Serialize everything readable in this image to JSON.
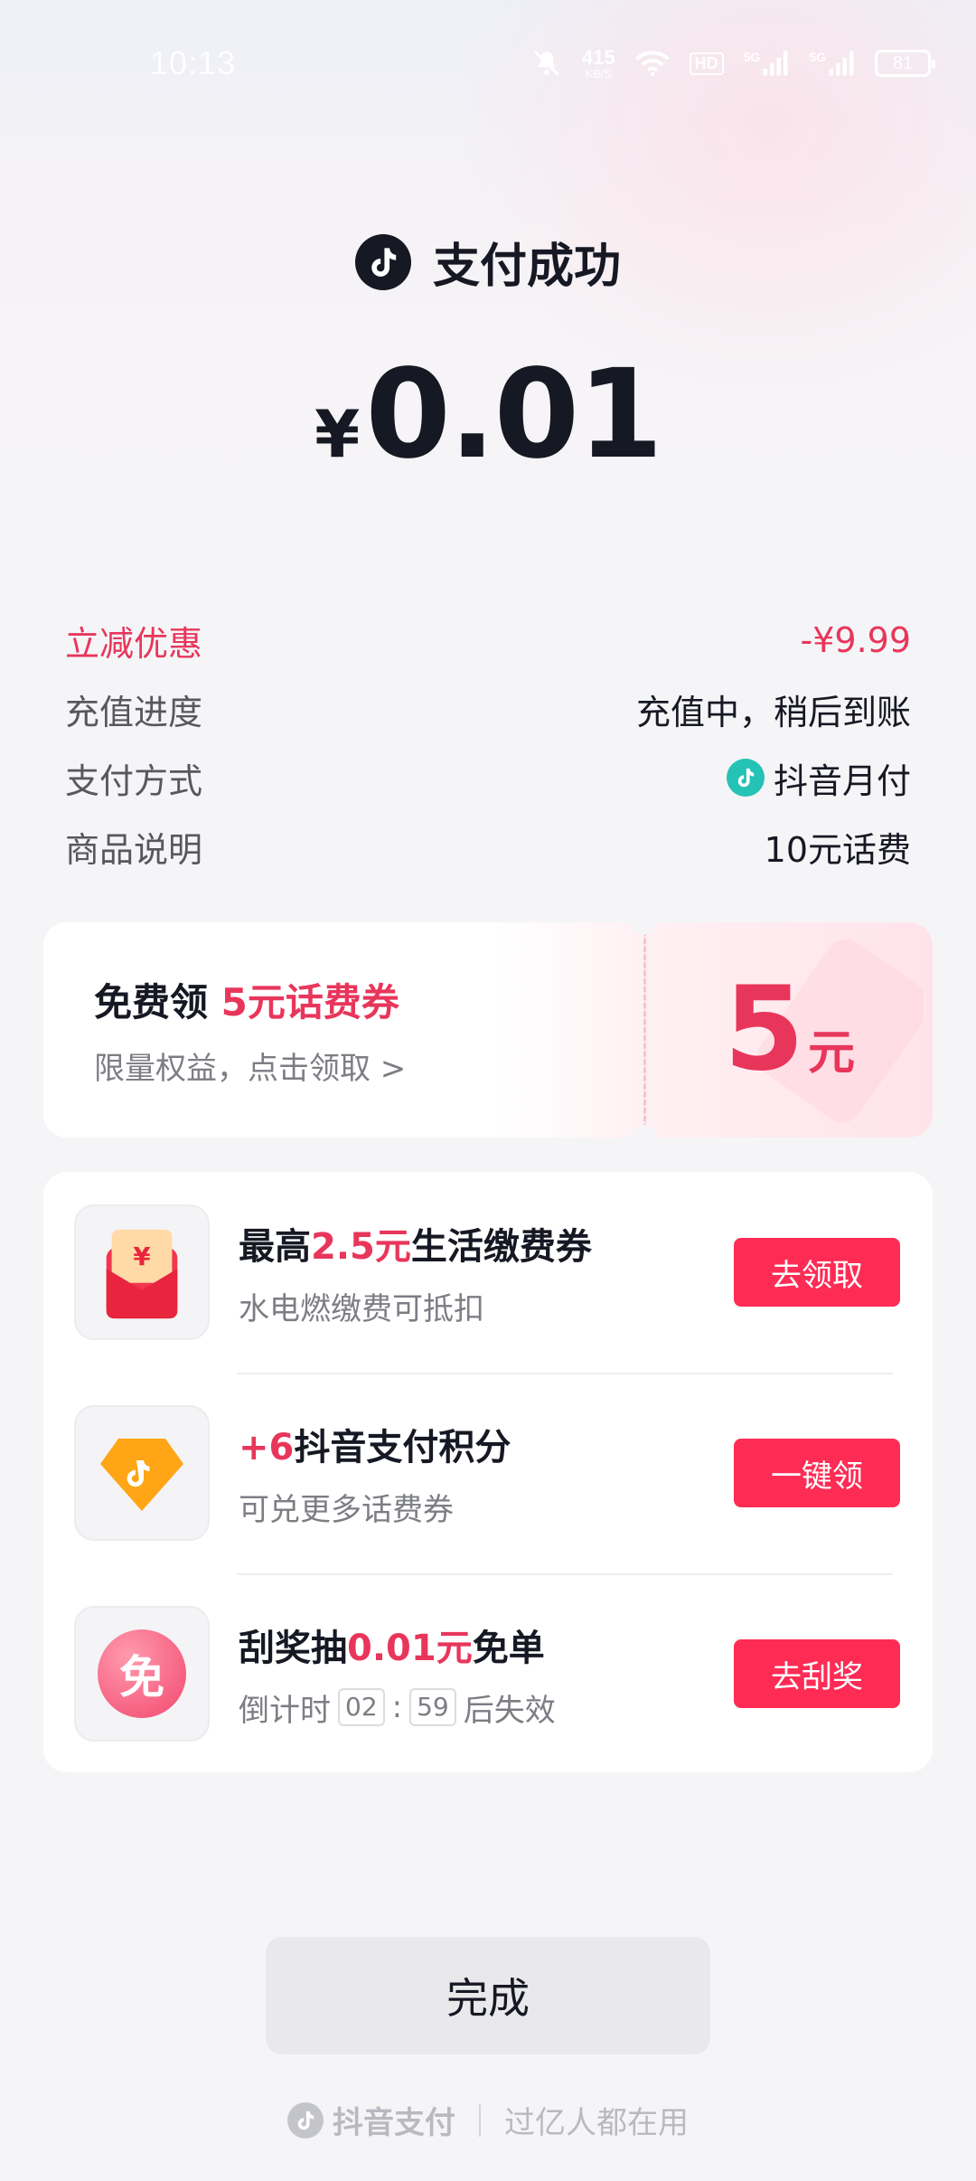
{
  "status_bar": {
    "time": "10:13",
    "speed_value": "415",
    "speed_unit": "KB/S",
    "hd_label": "HD",
    "signal_1": "5G",
    "signal_2": "5G",
    "battery": "81"
  },
  "header": {
    "title": "支付成功",
    "currency": "¥",
    "amount": "0.01"
  },
  "details": [
    {
      "label": "立减优惠",
      "value": "-¥9.99"
    },
    {
      "label": "充值进度",
      "value": "充值中，稍后到账"
    },
    {
      "label": "支付方式",
      "value": "抖音月付"
    },
    {
      "label": "商品说明",
      "value": "10元话费"
    }
  ],
  "coupon": {
    "title_prefix": "免费领 ",
    "title_highlight": "5元话费券",
    "subtitle": "限量权益，点击领取 >",
    "value": "5",
    "unit": "元"
  },
  "tasks": [
    {
      "title_prefix": "最高",
      "title_highlight": "2.5元",
      "title_suffix": "生活缴费券",
      "subtitle": "水电燃缴费可抵扣",
      "button": "去领取",
      "icon": "red-envelope-icon"
    },
    {
      "title_prefix": "",
      "title_highlight": "+6",
      "title_suffix": "抖音支付积分",
      "subtitle": "可兑更多话费券",
      "button": "一键领",
      "icon": "points-gem-icon"
    },
    {
      "title_prefix": "刮奖抽",
      "title_highlight": "0.01元",
      "title_suffix": "免单",
      "subtitle_prefix": "倒计时",
      "countdown_min": "02",
      "countdown_sep": ":",
      "countdown_sec": "59",
      "subtitle_suffix": "后失效",
      "button": "去刮奖",
      "icon_text": "免",
      "icon": "free-badge-icon"
    }
  ],
  "done_button": "完成",
  "footer": {
    "brand": "抖音支付",
    "slogan": "过亿人都在用"
  },
  "colors": {
    "accent": "#fe2c55",
    "highlight_text": "#e8365b",
    "pay_logo": "#25c2b6"
  }
}
